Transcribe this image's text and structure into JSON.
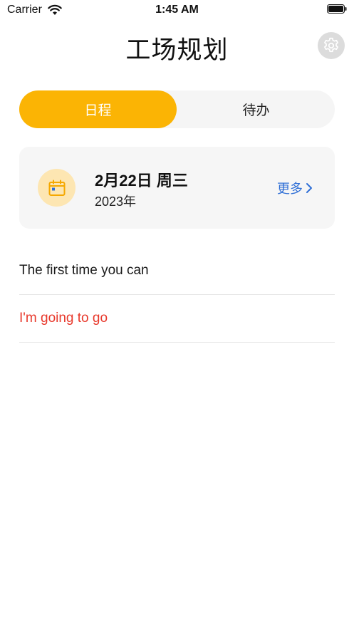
{
  "status_bar": {
    "carrier": "Carrier",
    "time": "1:45 AM"
  },
  "header": {
    "title": "工场规划",
    "settings_icon": "gear-icon"
  },
  "tabs": [
    {
      "label": "日程",
      "active": true
    },
    {
      "label": "待办",
      "active": false
    }
  ],
  "date_card": {
    "date": "2月22日 周三",
    "year": "2023年",
    "more_label": "更多",
    "icon": "calendar-icon"
  },
  "items": [
    {
      "text": "The first time you can",
      "color": "#1a1a1a"
    },
    {
      "text": "I'm going to go",
      "color": "#e8392c"
    }
  ],
  "colors": {
    "accent": "#fbb404",
    "link": "#2f6fd6",
    "alert": "#e8392c"
  }
}
